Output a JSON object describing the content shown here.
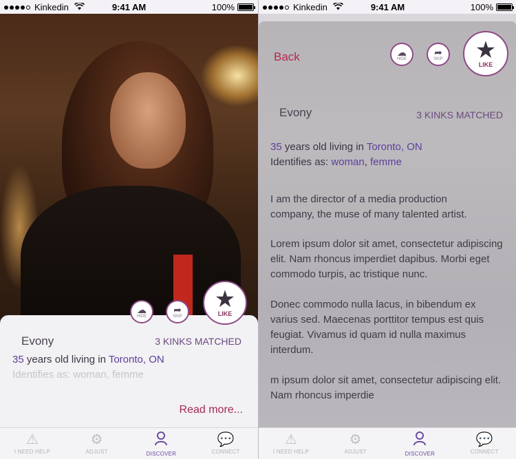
{
  "status_bar": {
    "carrier": "Kinkedin",
    "time": "9:41 AM",
    "battery": "100%",
    "battery_level": 1.0
  },
  "actions": {
    "hide_label": "HIDE",
    "skip_label": "SKIP",
    "like_label": "LIKE"
  },
  "profile": {
    "name": "Evony",
    "kinks_matched": "3 KINKS MATCHED",
    "age": "35",
    "age_suffix": "years old living in",
    "location": "Toronto, ON",
    "identifies_prefix": "Identifies as:",
    "identity_1": "woman",
    "identity_sep": ", ",
    "identity_2": "femme",
    "bio": [
      "I am the director of a media production company, the muse of many talented artist.",
      "Lorem ipsum dolor sit amet, consectetur adipiscing elit. Nam rhoncus imperdiet dapibus. Morbi eget commodo turpis, ac tristique nunc.",
      "Donec commodo nulla lacus, in bibendum ex varius sed. Maecenas porttitor tempus est quis feugiat. Vivamus id quam id nulla maximus interdum.",
      "m ipsum dolor sit amet, consectetur adipiscing elit. Nam rhoncus imperdie"
    ]
  },
  "read_more": "Read more...",
  "back_label": "Back",
  "tabs": [
    {
      "label": "I NEED HELP",
      "icon": "warning-icon"
    },
    {
      "label": "ADJUST",
      "icon": "gear-icon"
    },
    {
      "label": "DISCOVER",
      "icon": "person-icon",
      "active": true
    },
    {
      "label": "CONNECT",
      "icon": "chat-heart-icon"
    }
  ],
  "colors": {
    "accent": "#8c4a86",
    "link": "#5b3f9a",
    "brand_red": "#a22a55",
    "active_tab": "#6a4ca0"
  }
}
